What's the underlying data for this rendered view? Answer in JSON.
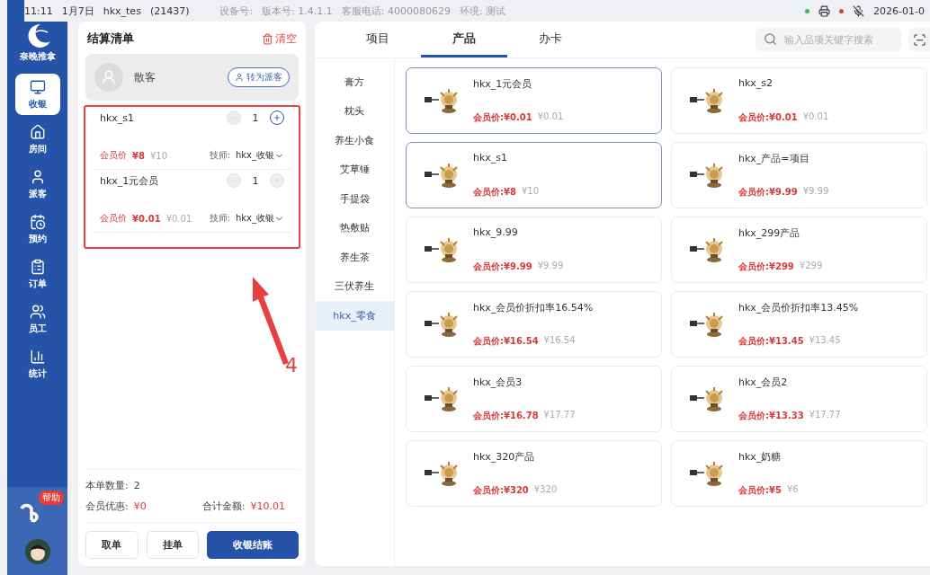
{
  "status_bar": {
    "time": "11:11",
    "date": "1月7日",
    "user": "hkx_tes",
    "store_id": "(21437)",
    "device": "设备号:",
    "version": "版本号: 1.4.1.1",
    "hotline": "客服电话: 4000080629",
    "env": "环境: 测试",
    "datetime": "2026-01-0"
  },
  "sidebar": {
    "logo": "奈晚推拿",
    "items": [
      {
        "kind": "cashier",
        "label": "收银",
        "selected": true
      },
      {
        "kind": "room",
        "label": "房间",
        "selected": false
      },
      {
        "kind": "guest",
        "label": "派客",
        "selected": false
      },
      {
        "kind": "booking",
        "label": "预约",
        "selected": false
      },
      {
        "kind": "order",
        "label": "订单",
        "selected": false
      },
      {
        "kind": "staff",
        "label": "员工",
        "selected": false
      },
      {
        "kind": "stats",
        "label": "统计",
        "selected": false
      }
    ],
    "help_badge": "帮助"
  },
  "cart": {
    "title": "结算清单",
    "clear": "清空",
    "customer": "散客",
    "convert_button": "转为派客",
    "items": [
      {
        "name": "hkx_s1",
        "quantity": "1",
        "plus_enabled": true,
        "member_label": "会员价",
        "member_price": "¥8",
        "price": "¥10",
        "tech_label": "技师:",
        "tech": "hkx_收银"
      },
      {
        "name": "hkx_1元会员",
        "quantity": "1",
        "plus_enabled": false,
        "member_label": "会员价",
        "member_price": "¥0.01",
        "price": "¥0.01",
        "tech_label": "技师:",
        "tech": "hkx_收银"
      }
    ],
    "count_label": "本单数量:",
    "count": "2",
    "discount_label": "会员优惠:",
    "discount": "¥0",
    "total_label": "合计金额:",
    "total": "¥10.01",
    "buttons": [
      {
        "kind": "plain",
        "label": "取单"
      },
      {
        "kind": "plain",
        "label": "挂单"
      },
      {
        "kind": "primary",
        "label": "收银结账"
      }
    ]
  },
  "annotation": {
    "label": "4"
  },
  "tabs": [
    {
      "label": "项目",
      "selected": false
    },
    {
      "label": "产品",
      "selected": true
    },
    {
      "label": "办卡",
      "selected": false
    }
  ],
  "search": {
    "placeholder": "输入品项关键字搜索"
  },
  "categories": [
    {
      "label": "膏方",
      "selected": false
    },
    {
      "label": "枕头",
      "selected": false
    },
    {
      "label": "养生小食",
      "selected": false
    },
    {
      "label": "艾草锤",
      "selected": false
    },
    {
      "label": "手提袋",
      "selected": false
    },
    {
      "label": "热敷贴",
      "selected": false
    },
    {
      "label": "养生茶",
      "selected": false
    },
    {
      "label": "三伏养生",
      "selected": false
    },
    {
      "label": "hkx_零食",
      "selected": true
    }
  ],
  "products": [
    {
      "name": "hkx_1元会员",
      "member_price": "会员价:¥0.01",
      "price": "¥0.01",
      "selected": true
    },
    {
      "name": "hkx_s2",
      "member_price": "会员价:¥0.01",
      "price": "¥0.01",
      "selected": false
    },
    {
      "name": "hkx_s1",
      "member_price": "会员价:¥8",
      "price": "¥10",
      "selected": true
    },
    {
      "name": "hkx_产品=项目",
      "member_price": "会员价:¥9.99",
      "price": "¥9.99",
      "selected": false
    },
    {
      "name": "hkx_9.99",
      "member_price": "会员价:¥9.99",
      "price": "¥9.99",
      "selected": false
    },
    {
      "name": "hkx_299产品",
      "member_price": "会员价:¥299",
      "price": "¥299",
      "selected": false
    },
    {
      "name": "hkx_会员价折扣率16.54%",
      "member_price": "会员价:¥16.54",
      "price": "¥16.54",
      "selected": false
    },
    {
      "name": "hkx_会员价折扣率13.45%",
      "member_price": "会员价:¥13.45",
      "price": "¥13.45",
      "selected": false
    },
    {
      "name": "hkx_会员3",
      "member_price": "会员价:¥16.78",
      "price": "¥17.77",
      "selected": false
    },
    {
      "name": "hkx_会员2",
      "member_price": "会员价:¥13.33",
      "price": "¥17.77",
      "selected": false
    },
    {
      "name": "hkx_320产品",
      "member_price": "会员价:¥320",
      "price": "¥320",
      "selected": false
    },
    {
      "name": "hkx_奶糖",
      "member_price": "会员价:¥5",
      "price": "¥6",
      "selected": false
    }
  ]
}
